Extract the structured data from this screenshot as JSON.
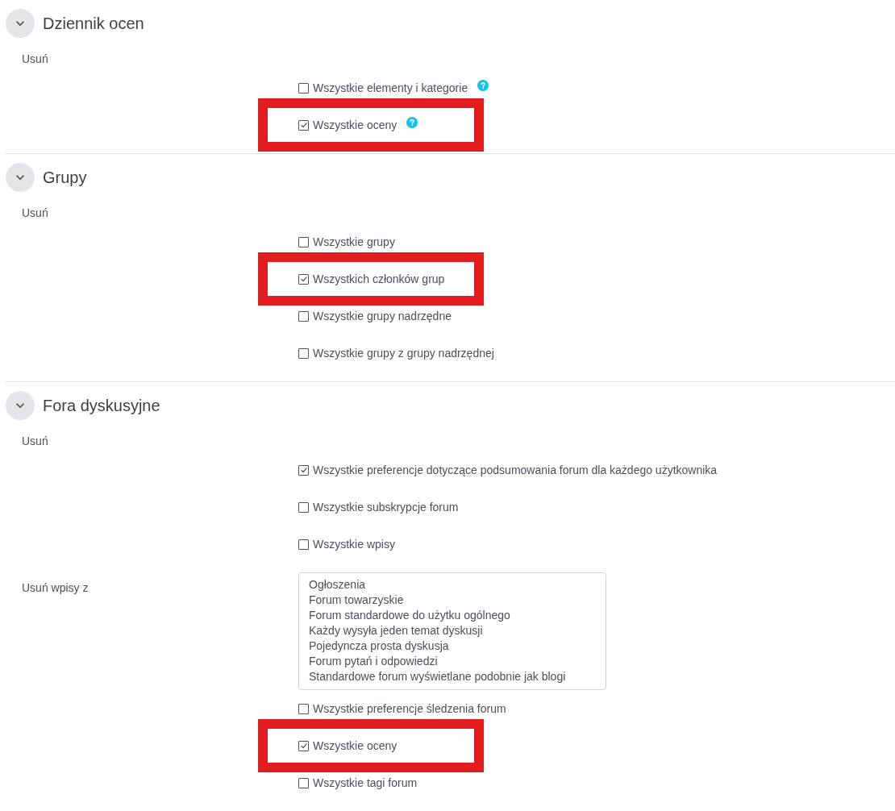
{
  "sections": [
    {
      "title": "Dziennik ocen",
      "expanded": true,
      "fields": [
        {
          "kind": "checkboxes",
          "label": "Usuń",
          "items": [
            {
              "label": "Wszystkie elementy i kategorie",
              "checked": false,
              "help": true,
              "highlighted": false
            },
            {
              "label": "Wszystkie oceny",
              "checked": true,
              "help": true,
              "highlighted": true
            }
          ]
        }
      ]
    },
    {
      "title": "Grupy",
      "expanded": true,
      "fields": [
        {
          "kind": "checkboxes",
          "label": "Usuń",
          "items": [
            {
              "label": "Wszystkie grupy",
              "checked": false,
              "help": false,
              "highlighted": false
            },
            {
              "label": "Wszystkich członków grup",
              "checked": true,
              "help": false,
              "highlighted": true
            },
            {
              "label": "Wszystkie grupy nadrzędne",
              "checked": false,
              "help": false,
              "highlighted": false
            },
            {
              "label": "Wszystkie grupy z grupy nadrzędnej",
              "checked": false,
              "help": false,
              "highlighted": false
            }
          ]
        }
      ]
    },
    {
      "title": "Fora dyskusyjne",
      "expanded": true,
      "fields": [
        {
          "kind": "checkboxes",
          "label": "Usuń",
          "items": [
            {
              "label": "Wszystkie preferencje dotyczące podsumowania forum dla każdego użytkownika",
              "checked": true,
              "help": false,
              "highlighted": false
            },
            {
              "label": "Wszystkie subskrypcje forum",
              "checked": false,
              "help": false,
              "highlighted": false
            },
            {
              "label": "Wszystkie wpisy",
              "checked": false,
              "help": false,
              "highlighted": false
            }
          ]
        },
        {
          "kind": "listbox",
          "label": "Usuń wpisy z",
          "options": [
            "Ogłoszenia",
            "Forum towarzyskie",
            "Forum standardowe do użytku ogólnego",
            "Każdy wysyła jeden temat dyskusji",
            "Pojedyncza prosta dyskusja",
            "Forum pytań i odpowiedzi",
            "Standardowe forum wyświetlane podobnie jak blogi"
          ]
        },
        {
          "kind": "checkboxes",
          "items": [
            {
              "label": "Wszystkie preferencje śledzenia forum",
              "checked": false,
              "help": false,
              "highlighted": false
            },
            {
              "label": "Wszystkie oceny",
              "checked": true,
              "help": false,
              "highlighted": true
            },
            {
              "label": "Wszystkie tagi forum",
              "checked": false,
              "help": false,
              "highlighted": false
            }
          ]
        }
      ]
    }
  ]
}
